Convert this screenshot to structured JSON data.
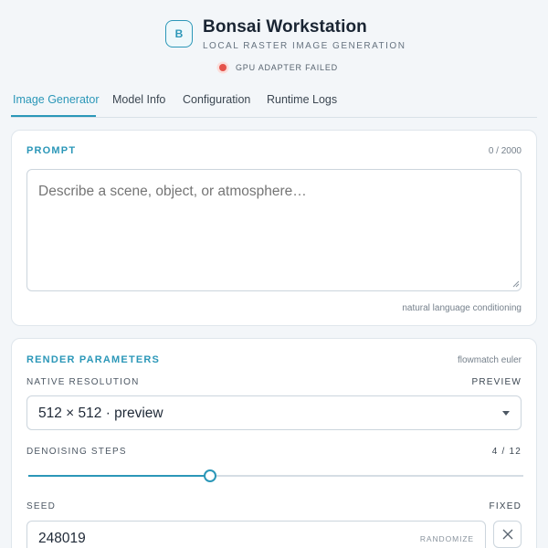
{
  "app": {
    "logo_letter": "B",
    "title": "Bonsai Workstation",
    "subtitle": "LOCAL RASTER IMAGE GENERATION",
    "status": "GPU ADAPTER FAILED",
    "status_color": "#e5534b",
    "accent_color": "#2b97b8"
  },
  "tabs": [
    {
      "label": "Image Generator",
      "active": true
    },
    {
      "label": "Model Info",
      "active": false
    },
    {
      "label": "Configuration",
      "active": false
    },
    {
      "label": "Runtime Logs",
      "active": false
    }
  ],
  "prompt": {
    "title": "PROMPT",
    "counter": "0 / 2000",
    "placeholder": "Describe a scene, object, or atmosphere…",
    "value": "",
    "hint": "natural language conditioning"
  },
  "render": {
    "title": "RENDER PARAMETERS",
    "sampler": "flowmatch euler",
    "resolution": {
      "label": "NATIVE RESOLUTION",
      "mode": "PREVIEW",
      "selected": "512 × 512 · preview"
    },
    "steps": {
      "label": "DENOISING STEPS",
      "value": 4,
      "max": 12,
      "readout": "4 / 12"
    },
    "seed": {
      "label": "SEED",
      "mode": "FIXED",
      "value": "248019",
      "randomize_label": "RANDOMIZE",
      "clear_icon": "close-icon"
    }
  }
}
